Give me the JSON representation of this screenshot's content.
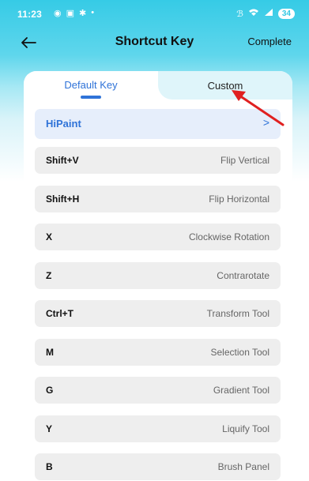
{
  "status_bar": {
    "time": "11:23",
    "battery": "34"
  },
  "header": {
    "title": "Shortcut Key",
    "complete_label": "Complete"
  },
  "tabs": [
    {
      "label": "Default Key",
      "selected": true
    },
    {
      "label": "Custom",
      "selected": false
    }
  ],
  "group": {
    "name": "HiPaint",
    "chevron": ">"
  },
  "shortcuts": [
    {
      "key": "Shift+V",
      "action": "Flip Vertical"
    },
    {
      "key": "Shift+H",
      "action": "Flip Horizontal"
    },
    {
      "key": "X",
      "action": "Clockwise Rotation"
    },
    {
      "key": "Z",
      "action": "Contrarotate"
    },
    {
      "key": "Ctrl+T",
      "action": "Transform Tool"
    },
    {
      "key": "M",
      "action": "Selection Tool"
    },
    {
      "key": "G",
      "action": "Gradient Tool"
    },
    {
      "key": "Y",
      "action": "Liquify Tool"
    },
    {
      "key": "B",
      "action": "Brush Panel"
    }
  ],
  "colors": {
    "accent": "#2f73d8",
    "header_bg": "#36cbe6",
    "annotation_arrow": "#e02020"
  },
  "icons": {
    "back": "arrow-left-icon",
    "annotation": "red-arrow-icon"
  }
}
